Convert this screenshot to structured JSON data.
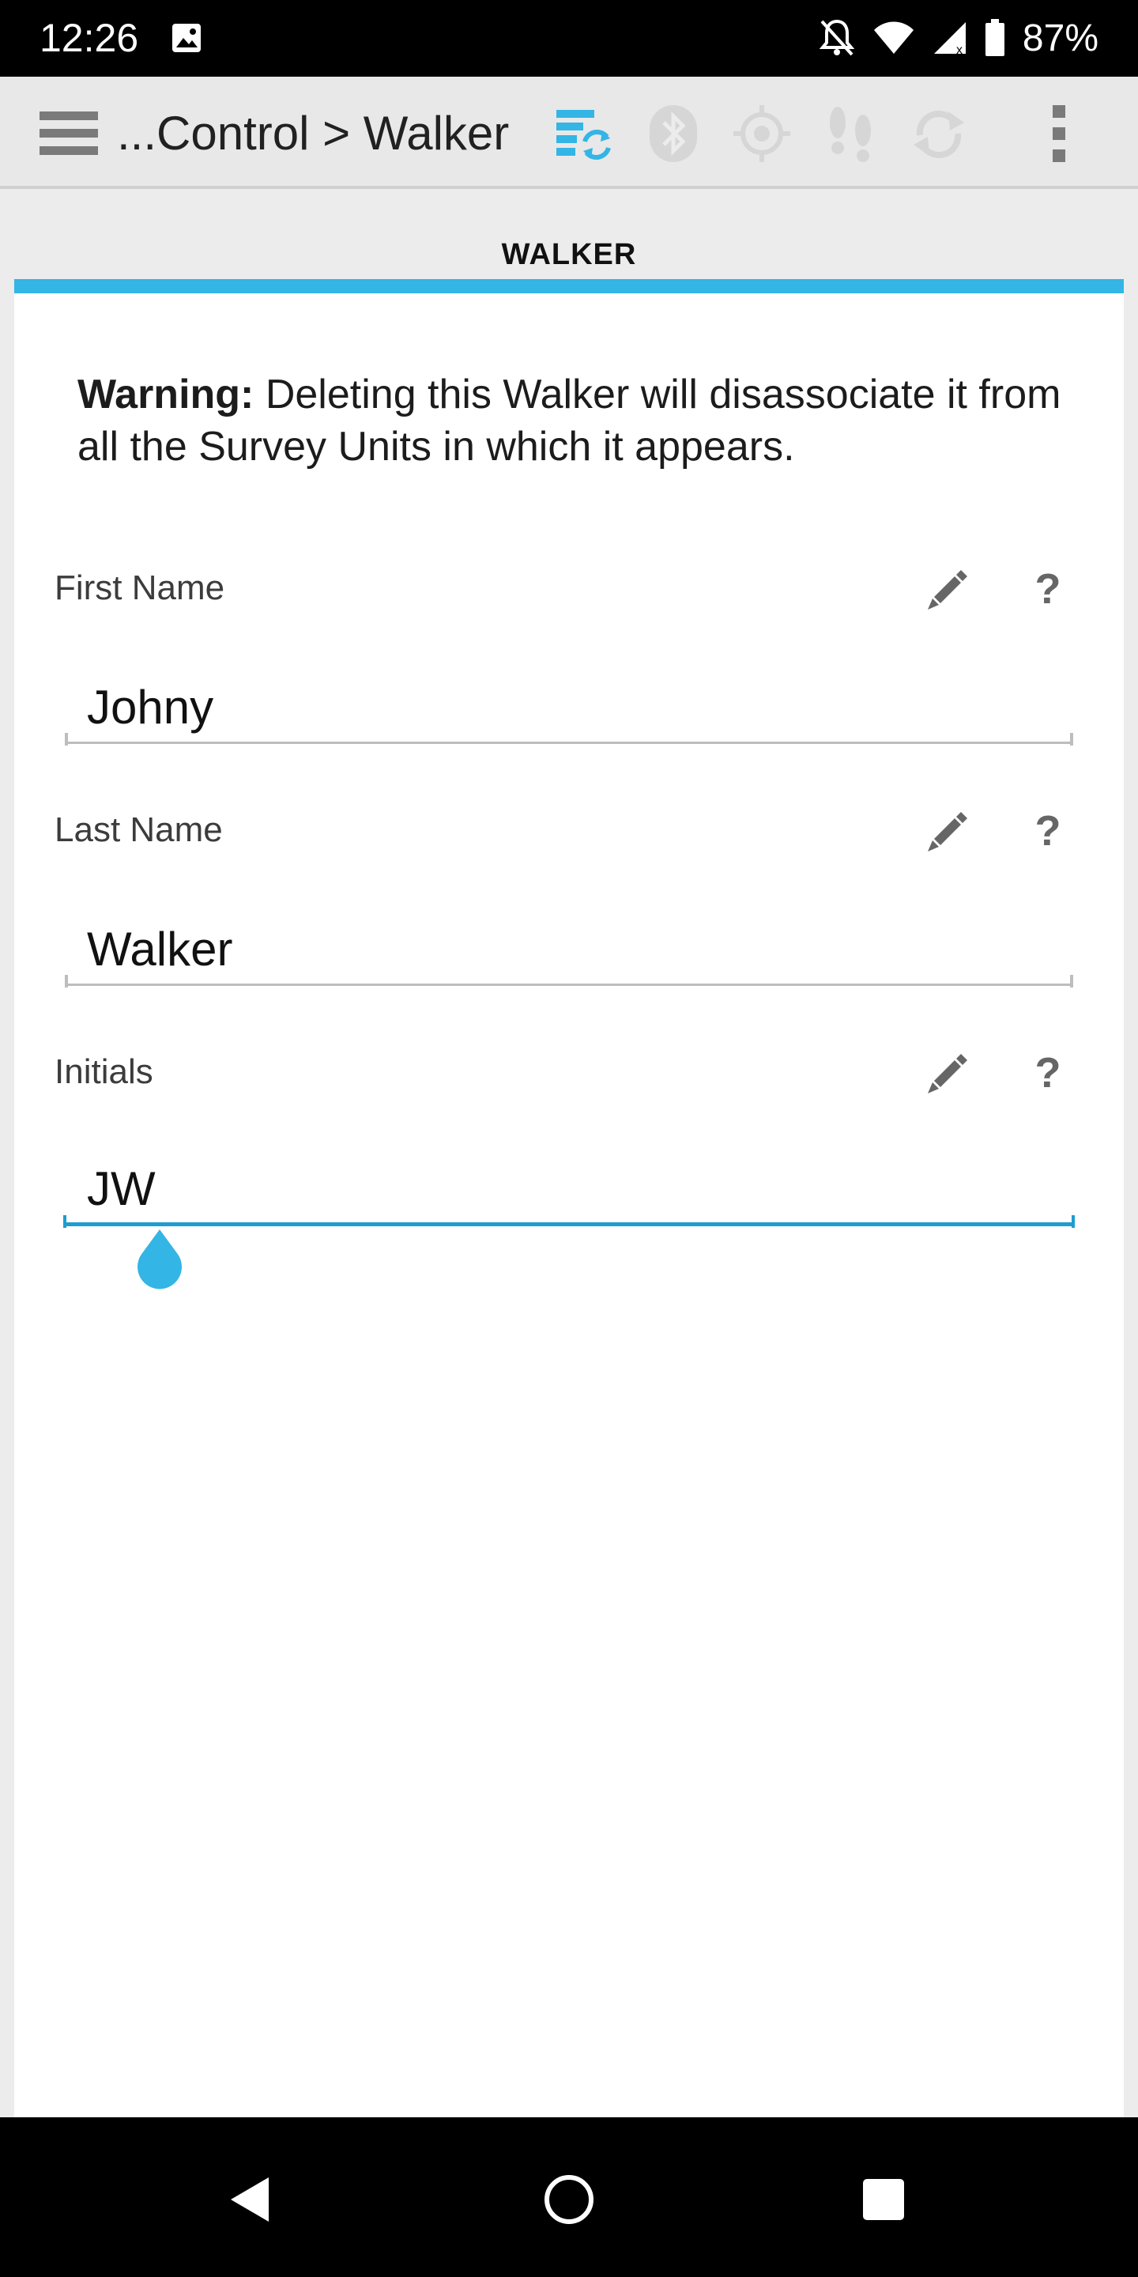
{
  "status_bar": {
    "time": "12:26",
    "battery": "87%",
    "icons": [
      "image-icon",
      "notifications-off-icon",
      "wifi-icon",
      "signal-icon",
      "battery-icon"
    ]
  },
  "toolbar": {
    "breadcrumb": "...Control > Walker",
    "icons": [
      "menu-icon",
      "sync-icon",
      "bluetooth-icon",
      "gps-icon",
      "footsteps-icon",
      "refresh-icon",
      "overflow-menu-icon"
    ]
  },
  "tab": {
    "label": "WALKER"
  },
  "warning": {
    "bold": "Warning:",
    "text": " Deleting this Walker will disassociate it from all the Survey Units in which it appears."
  },
  "fields": {
    "first_name": {
      "label": "First Name",
      "value": "Johny"
    },
    "last_name": {
      "label": "Last Name",
      "value": "Walker"
    },
    "initials": {
      "label": "Initials",
      "value": "JW"
    }
  },
  "help_glyph": "?",
  "colors": {
    "accent": "#33b5e5",
    "focus_line": "#1e9dd1",
    "icon_gray": "#666666"
  }
}
